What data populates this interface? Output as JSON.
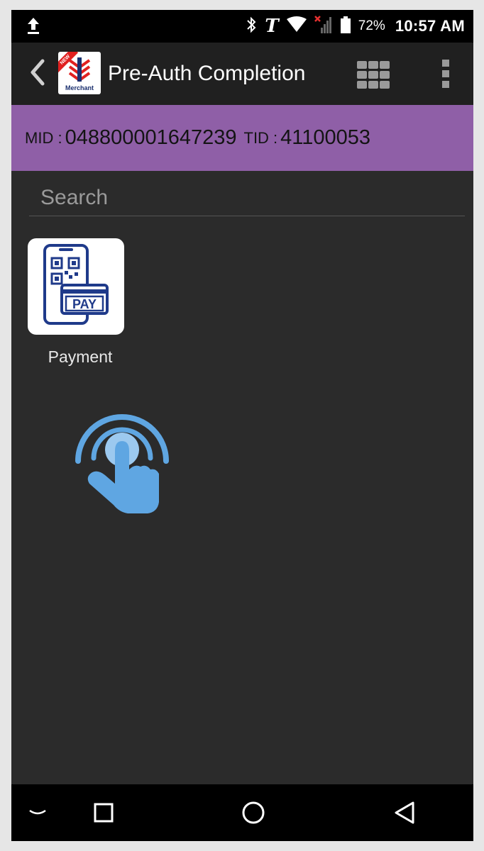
{
  "status_bar": {
    "carrier_glyph": "T",
    "battery_percent": "72%",
    "time": "10:57 AM"
  },
  "app_bar": {
    "logo_text": "Merchant",
    "logo_badge": "NEW",
    "title": "Pre-Auth Completion"
  },
  "ids": {
    "mid_label": "MID :",
    "mid_value": "048800001647239",
    "tid_label": "TID :",
    "tid_value": "41100053"
  },
  "search": {
    "placeholder": "Search",
    "value": ""
  },
  "tiles": [
    {
      "label": "Payment",
      "badge_text": "PAY",
      "icon": "qr-phone-pay-icon"
    }
  ],
  "colors": {
    "id_band": "#8f5fa7",
    "app_bar": "#202020",
    "background": "#2b2b2b",
    "tile_icon": "#1f3a8a",
    "gesture": "#5fa6e2"
  }
}
